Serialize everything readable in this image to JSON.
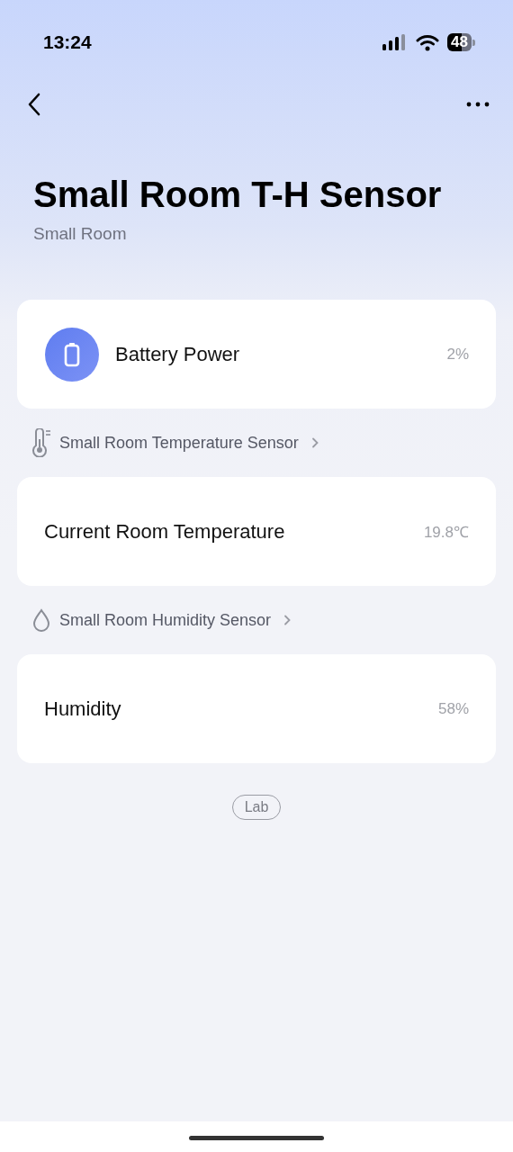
{
  "status_bar": {
    "time": "13:24",
    "battery": "48"
  },
  "title": "Small Room T-H Sensor",
  "subtitle": "Small Room",
  "sections": [
    {
      "card": {
        "label": "Battery Power",
        "value": "2%",
        "kind": "battery"
      }
    },
    {
      "header": {
        "label": "Small Room Temperature Sensor",
        "kind": "thermometer"
      },
      "card": {
        "label": "Current Room Temperature",
        "value": "19.8℃"
      }
    },
    {
      "header": {
        "label": "Small Room Humidity Sensor",
        "kind": "drop"
      },
      "card": {
        "label": "Humidity",
        "value": "58%"
      }
    }
  ],
  "tag": "Lab"
}
